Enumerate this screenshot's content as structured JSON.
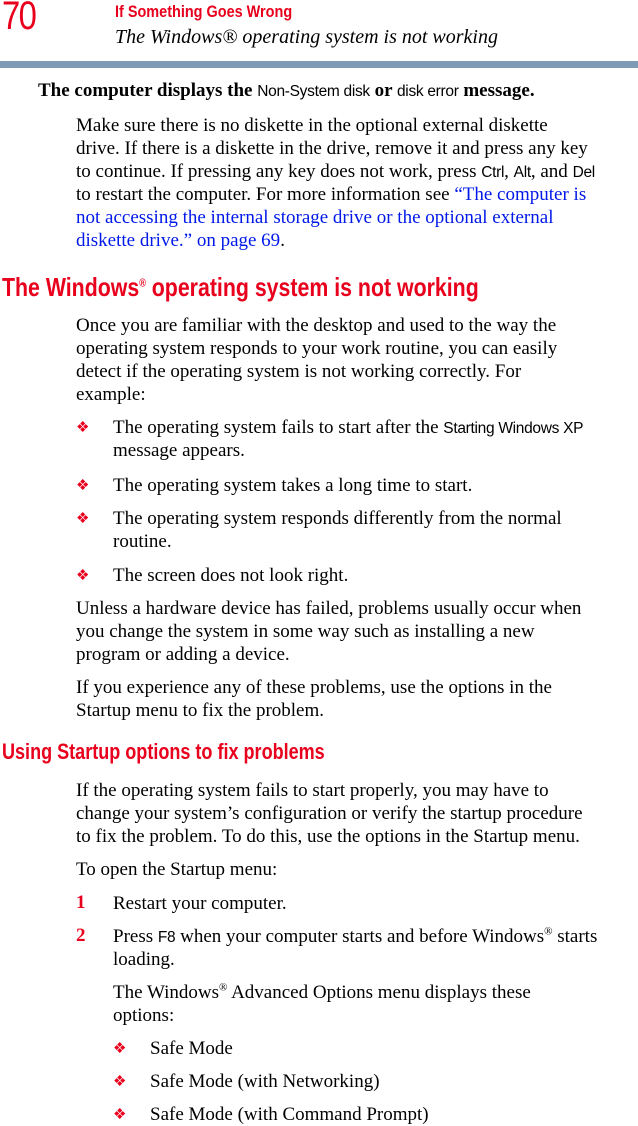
{
  "header": {
    "page_number": "70",
    "chapter": "If Something Goes Wrong",
    "section": "The Windows® operating system is not working",
    "rule_color": "#7f9ab5"
  },
  "lead": {
    "part1": "The computer displays the ",
    "code1": "Non-System disk",
    "part2": " or ",
    "code2": "disk error",
    "part3": " message."
  },
  "para1": {
    "l1": "Make sure there is no diskette in the optional external diskette",
    "l2": "drive. If there is a diskette in the drive, remove it and press any key",
    "l3a": "to continue. If pressing any key does not work, press ",
    "l3k1": "Ctrl",
    "l3b": ", ",
    "l3k2": "Alt",
    "l3c": ", and ",
    "l3k3": "Del",
    "l4a": "to restart the computer. For more information see ",
    "l4link": "“The computer is",
    "l5link": "not accessing the internal storage drive or the optional external",
    "l6link": "diskette drive.” on page 69",
    "l6end": "."
  },
  "heading1": {
    "a": "The Windows",
    "reg": "®",
    "b": " operating system is not working"
  },
  "para2": {
    "l1": "Once you are familiar with the desktop and used to the way the",
    "l2": "operating system responds to your work routine, you can easily",
    "l3": "detect if the operating system is not working correctly. For",
    "l4": "example:"
  },
  "bullets1": {
    "b1a": "The operating system fails to start after the ",
    "b1code": "Starting Windows  XP",
    "b1b": "message appears.",
    "b2": "The operating system takes a long time to start.",
    "b3a": "The operating system responds differently from the normal",
    "b3b": "routine.",
    "b4": "The screen does not look right."
  },
  "para3": {
    "l1": "Unless a hardware device has failed, problems usually occur when",
    "l2": "you change the system in some way such as installing a new",
    "l3": "program or adding a device."
  },
  "para4": {
    "l1": "If you experience any of these problems, use the options in the",
    "l2": "Startup menu to fix the problem."
  },
  "heading2": "Using Startup options to fix problems",
  "para5": {
    "l1": "If the operating system fails to start properly, you may have to",
    "l2": "change your system’s configuration or verify the startup procedure",
    "l3": "to fix the problem. To do this, use the options in the Startup menu."
  },
  "para6": "To open the Startup menu:",
  "steps": {
    "n1": "1",
    "s1": "Restart your computer.",
    "n2": "2",
    "s2a": "Press ",
    "s2key": "F8",
    "s2b": " when your computer starts and before Windows",
    "s2reg": "®",
    "s2c": " starts",
    "s2d": "loading."
  },
  "para7": {
    "a": "The Windows",
    "reg": "®",
    "b": " Advanced Options menu displays these",
    "l2": "options:"
  },
  "options": [
    "Safe Mode",
    "Safe Mode (with Networking)",
    "Safe Mode (with Command Prompt)"
  ],
  "bullet_glyph": "❖"
}
